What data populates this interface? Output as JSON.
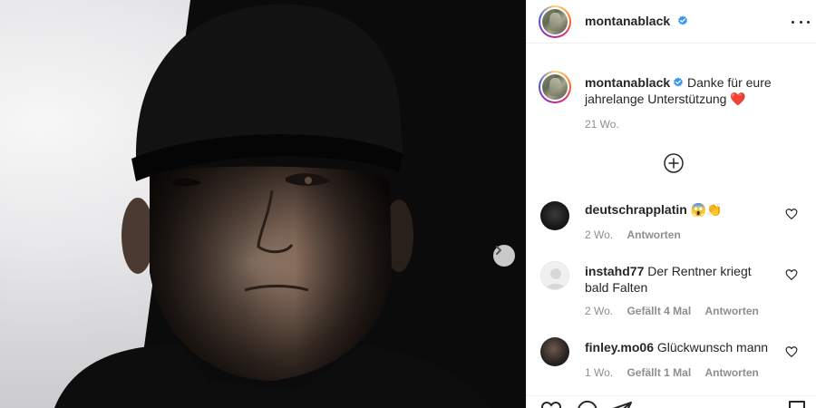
{
  "post": {
    "author": "montanablack",
    "caption": "Danke für eure jahrelange Unterstützung",
    "caption_emoji": "❤️",
    "time_ago": "21 Wo."
  },
  "comments": [
    {
      "user": "deutschrapplatin",
      "text": "😱👏",
      "time_ago": "2 Wo.",
      "likes": "",
      "reply": "Antworten"
    },
    {
      "user": "instahd77",
      "text": "Der Rentner kriegt bald Falten",
      "time_ago": "2 Wo.",
      "likes": "Gefällt 4 Mal",
      "reply": "Antworten"
    },
    {
      "user": "finley.mo06",
      "text": "Glückwunsch mann",
      "time_ago": "1 Wo.",
      "likes": "Gefällt 1 Mal",
      "reply": "Antworten"
    }
  ],
  "icons": {
    "more": "more-options-icon",
    "verified": "verified-badge-icon",
    "load_more": "plus-circle-icon",
    "next": "chevron-right-icon",
    "heart": "heart-outline-icon",
    "comment": "comment-icon",
    "share": "share-icon",
    "save": "bookmark-icon"
  },
  "colors": {
    "verified_blue": "#3897f0",
    "text": "#262626",
    "meta_gray": "#8e8e8e"
  }
}
